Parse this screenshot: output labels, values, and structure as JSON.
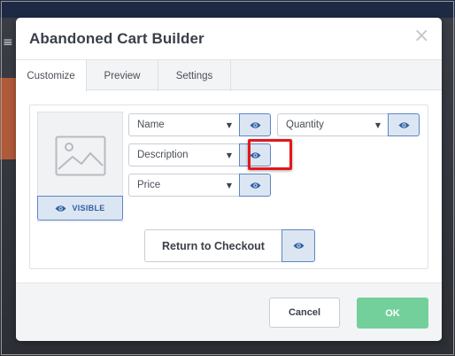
{
  "modal": {
    "title": "Abandoned Cart Builder",
    "close_glyph": "×"
  },
  "tabs": [
    {
      "label": "Customize",
      "active": true
    },
    {
      "label": "Preview",
      "active": false
    },
    {
      "label": "Settings",
      "active": false
    }
  ],
  "image_block": {
    "visibility_label": "VISIBLE",
    "placeholder_icon": "image-placeholder-icon"
  },
  "fields": {
    "name": {
      "value": "Name",
      "visibility_icon": "eye-icon"
    },
    "quantity": {
      "value": "Quantity",
      "visibility_icon": "eye-icon"
    },
    "description": {
      "value": "Description",
      "visibility_icon": "eye-icon",
      "highlighted": true
    },
    "price": {
      "value": "Price",
      "visibility_icon": "eye-icon"
    }
  },
  "return_button": {
    "label": "Return to Checkout",
    "visibility_icon": "eye-icon"
  },
  "footer": {
    "cancel_label": "Cancel",
    "ok_label": "OK"
  },
  "colors": {
    "accent_blue": "#5b86c4",
    "toggle_bg": "#dce6f3",
    "ok_green": "#74d09a",
    "highlight_red": "#e3171b"
  }
}
